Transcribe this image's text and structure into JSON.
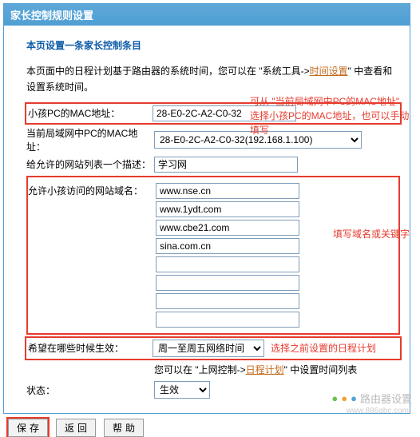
{
  "title": "家长控制规则设置",
  "subtitle": "本页设置一条家长控制条目",
  "desc_prefix": "本页面中的日程计划基于路由器的系统时间，您可以在 \"系统工具->",
  "desc_link": "时间设置",
  "desc_suffix": "\" 中查看和设置系统时间。",
  "note_top_1": "可从 \"当前局域网中PC的MAC地址\"",
  "note_top_2": "选择小孩PC的MAC地址，也可以手动",
  "note_top_3": "填写",
  "labels": {
    "child_mac": "小孩PC的MAC地址：",
    "lan_mac": "当前局域网中PC的MAC地址：",
    "list_desc": "给允许的网站列表一个描述：",
    "allowed_domains": "允许小孩访问的网站域名：",
    "effective": "希望在哪些时候生效：",
    "status": "状态："
  },
  "fields": {
    "child_mac": "28-E0-2C-A2-C0-32",
    "lan_mac_selected": "28-E0-2C-A2-C0-32(192.168.1.100)",
    "list_desc": "学习网",
    "domains": [
      "www.nse.cn",
      "www.1ydt.com",
      "www.cbe21.com",
      "sina.com.cn",
      "",
      "",
      "",
      ""
    ],
    "effective_selected": "周一至周五网络时间",
    "status_selected": "生效"
  },
  "note_domains": "填写域名或关键字",
  "note_schedule_inline": "选择之前设置的日程计划",
  "helper_prefix": "您可以在 \"上网控制->",
  "helper_link": "日程计划",
  "helper_suffix": "\" 中设置时间列表",
  "buttons": {
    "save": "保存",
    "back": "返回",
    "help": "帮助"
  },
  "watermark": {
    "url": "www.886abc.com",
    "text": "路由器设置"
  }
}
